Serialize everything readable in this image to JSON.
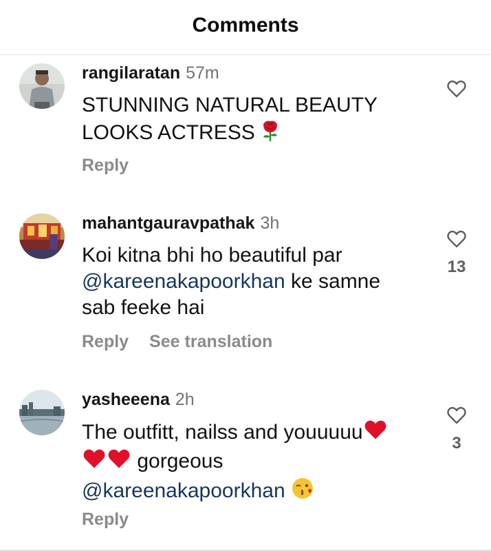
{
  "header": {
    "title": "Comments"
  },
  "comments": [
    {
      "username": "rangilaratan",
      "time": "57m",
      "text_lines": [
        "STUNNING NATURAL BEAUTY",
        "LOOKS ACTRESS"
      ],
      "emoji": "rose-emoji",
      "actions": {
        "reply": "Reply"
      },
      "likes": ""
    },
    {
      "username": "mahantgauravpathak",
      "time": "3h",
      "text_line1": "Koi kitna bhi ho beautiful par",
      "mention": "@kareenakapoorkhan",
      "text_after_mention": " ke samne",
      "text_line3": "sab feeke hai",
      "actions": {
        "reply": "Reply",
        "translate": "See translation"
      },
      "likes": "13"
    },
    {
      "username": "yasheeena",
      "time": "2h",
      "text_line1": "The outfitt, nailss and youuuuu",
      "text_line2": "gorgeous",
      "mention": "@kareenakapoorkhan",
      "emojis": [
        "red-heart-emoji",
        "red-heart-emoji",
        "red-heart-emoji",
        "kissing-face-emoji"
      ],
      "actions": {
        "reply": "Reply"
      },
      "likes": "3"
    }
  ],
  "colors": {
    "text": "#111111",
    "meta_grey": "#737373",
    "action_grey": "#8a8a8a",
    "mention_blue": "#16355e",
    "heart_red": "#e0102b"
  }
}
